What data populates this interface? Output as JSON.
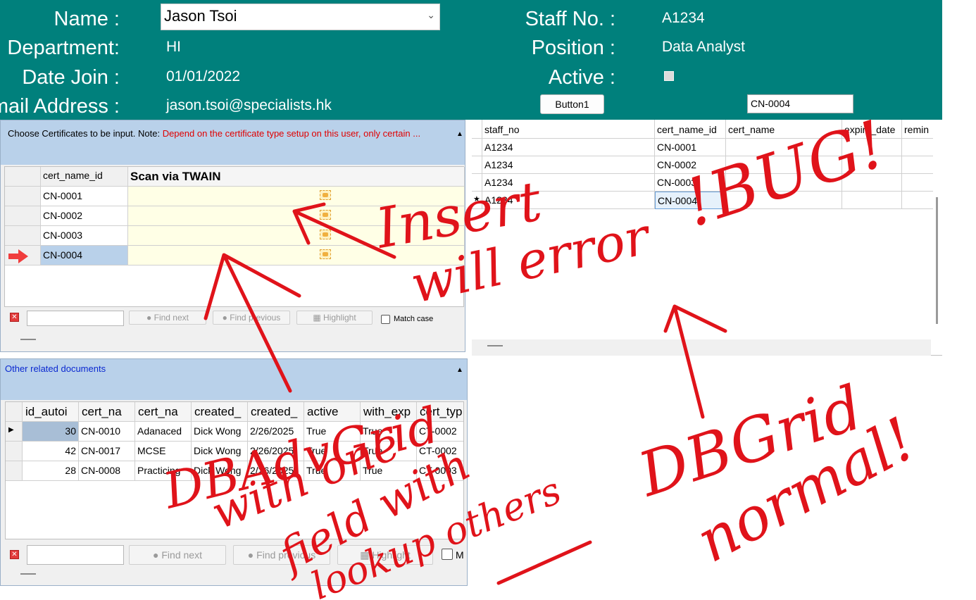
{
  "header": {
    "name_label": "Name :",
    "name_value": "Jason Tsoi",
    "department_label": "Department:",
    "department_value": "HI",
    "date_join_label": "Date Join :",
    "date_join_value": "01/01/2022",
    "email_label": "Email Address :",
    "email_value": "jason.tsoi@specialists.hk",
    "staff_no_label": "Staff No. :",
    "staff_no_value": "A1234",
    "position_label": "Position :",
    "position_value": "Data Analyst",
    "active_label": "Active :",
    "active_checked": false,
    "button1_label": "Button1",
    "cert_input_value": "CN-0004"
  },
  "cert_panel": {
    "title_prefix": "Choose Certificates to be input. Note: ",
    "title_note": "Depend on the certificate type setup on this user, only certain ...",
    "columns": [
      "cert_name_id",
      "Scan via TWAIN"
    ],
    "rows": [
      "CN-0001",
      "CN-0002",
      "CN-0003",
      "CN-0004"
    ],
    "selected_row": 3
  },
  "findbar": {
    "find_next": "Find next",
    "find_previous": "Find previous",
    "highlight": "Highlight",
    "match_case": "Match case"
  },
  "docs_panel": {
    "title": "Other related documents",
    "columns": [
      "id_autoi",
      "cert_na",
      "cert_na",
      "created_",
      "created_",
      "active",
      "with_exp",
      "cert_typ"
    ],
    "rows": [
      [
        "30",
        "CN-0010",
        "Adanaced",
        "Dick Wong",
        "2/26/2025",
        "True",
        "True",
        "CT-0002"
      ],
      [
        "42",
        "CN-0017",
        "MCSE",
        "Dick Wong",
        "2/26/2025",
        "True",
        "True",
        "CT-0002"
      ],
      [
        "28",
        "CN-0008",
        "Practicing",
        "Dick Wong",
        "2/26/2025",
        "True",
        "True",
        "CT-0003"
      ]
    ]
  },
  "dbgrid": {
    "columns": [
      "staff_no",
      "cert_name_id",
      "cert_name",
      "expiry_date",
      "remin"
    ],
    "rows": [
      [
        "A1234",
        "CN-0001"
      ],
      [
        "A1234",
        "CN-0002"
      ],
      [
        "A1234",
        "CN-0003"
      ],
      [
        "A1234",
        "CN-0004"
      ]
    ],
    "new_row_marker": "★"
  },
  "annotations": {
    "insert": "Insert",
    "will_error": "will error",
    "bug": "!BUG!",
    "db_adv_grid": "DBAdvGrid",
    "with_one": "with one",
    "field_with": "field with",
    "lookup_others": "lookup others",
    "dbgrid": "DBGrid",
    "normal": "normal!",
    "color": "#e0131a"
  }
}
